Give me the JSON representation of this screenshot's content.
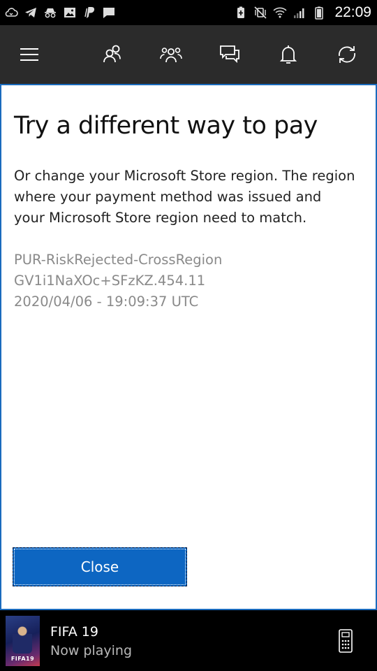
{
  "status_bar": {
    "time": "22:09",
    "left_icons": [
      "cloud-sync-icon",
      "telegram-icon",
      "incognito-icon",
      "image-icon",
      "paypal-icon",
      "message-icon"
    ],
    "right_icons": [
      "battery-saver-icon",
      "vibrate-mute-icon",
      "wifi-icon",
      "signal-icon",
      "battery-icon"
    ]
  },
  "toolbar": {
    "icons": [
      "menu-icon",
      "friends-icon",
      "party-icon",
      "messages-icon",
      "notifications-icon",
      "sync-icon"
    ]
  },
  "dialog": {
    "title": "Try a different way to pay",
    "message": "Or change your Microsoft Store region. The region where your payment method was issued and your Microsoft Store region need to match.",
    "error_lines": [
      "PUR-RiskRejected-CrossRegion",
      "GV1i1NaXOc+SFzKZ.454.11",
      "2020/04/06 - 19:09:37 UTC"
    ],
    "close_label": "Close"
  },
  "now_playing": {
    "game_title": "FIFA 19",
    "status": "Now playing",
    "art_label": "FIFA19"
  },
  "colors": {
    "accent": "#0d66c2",
    "toolbar_bg": "#2b2b2b",
    "dialog_border": "#1a6bbd"
  }
}
